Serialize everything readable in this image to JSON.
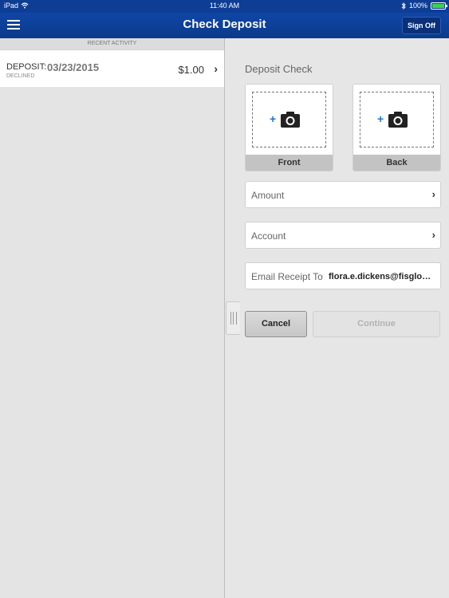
{
  "status_bar": {
    "device": "iPad",
    "time": "11:40 AM",
    "battery": "100%"
  },
  "nav": {
    "title": "Check Deposit",
    "sign_off": "Sign Off"
  },
  "activity": {
    "header": "RECENT ACTIVITY",
    "items": [
      {
        "type": "DEPOSIT:",
        "date": "03/23/2015",
        "status": "DECLINED",
        "amount": "$1.00"
      }
    ]
  },
  "deposit": {
    "title": "Deposit Check",
    "front_label": "Front",
    "back_label": "Back",
    "amount_label": "Amount",
    "account_label": "Account",
    "email_label": "Email Receipt To",
    "email_value": "flora.e.dickens@fisglob…",
    "cancel_label": "Cancel",
    "continue_label": "Continue"
  },
  "colors": {
    "nav_blue": "#0e3d96",
    "plus_blue": "#1a78d8"
  }
}
